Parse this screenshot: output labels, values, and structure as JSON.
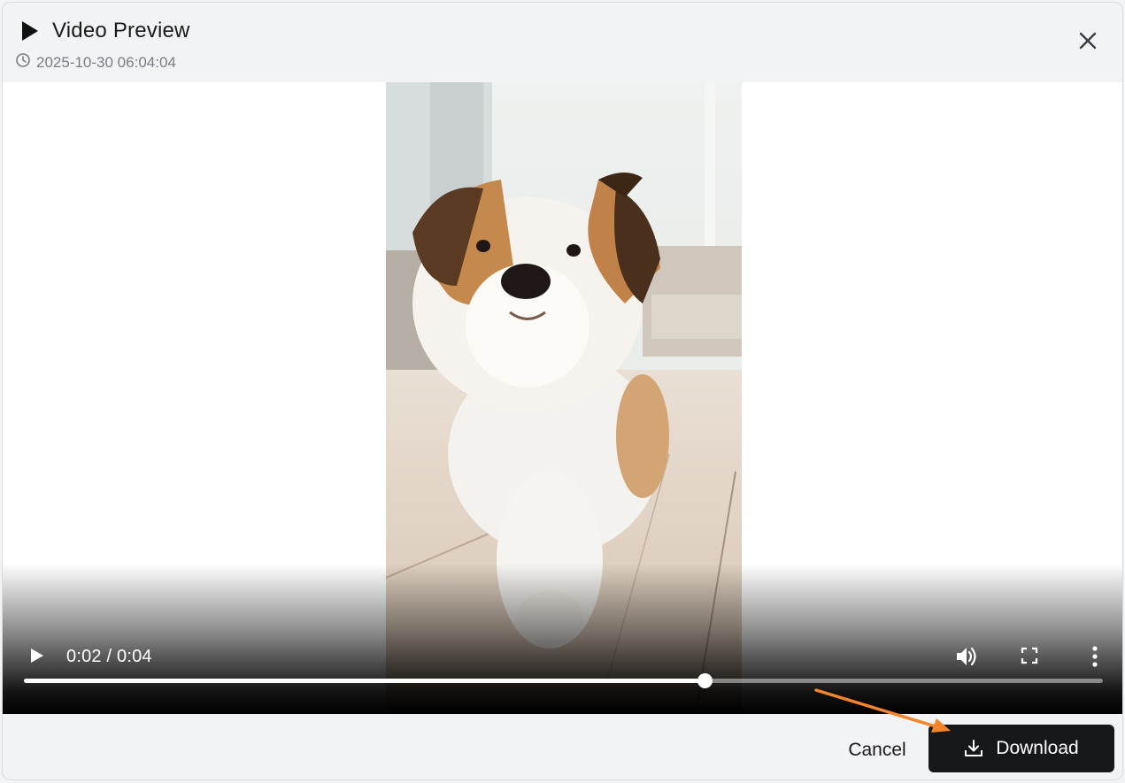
{
  "dialog": {
    "title": "Video Preview",
    "timestamp": "2025-10-30 06:04:04",
    "close_icon": "close-icon",
    "title_icon": "play-icon",
    "time_icon": "clock-icon"
  },
  "player": {
    "current_time": "0:02",
    "duration": "0:04",
    "time_display": "0:02 / 0:04",
    "progress": 0.631,
    "icons": [
      "play-icon",
      "volume-icon",
      "fullscreen-icon",
      "more-vertical-icon"
    ]
  },
  "footer": {
    "cancel_label": "Cancel",
    "download_label": "Download",
    "download_icon": "download-icon"
  },
  "colors": {
    "dialog_bg": "#f2f3f5",
    "primary_button": "#17181b",
    "annotation_arrow": "#f5852a"
  }
}
